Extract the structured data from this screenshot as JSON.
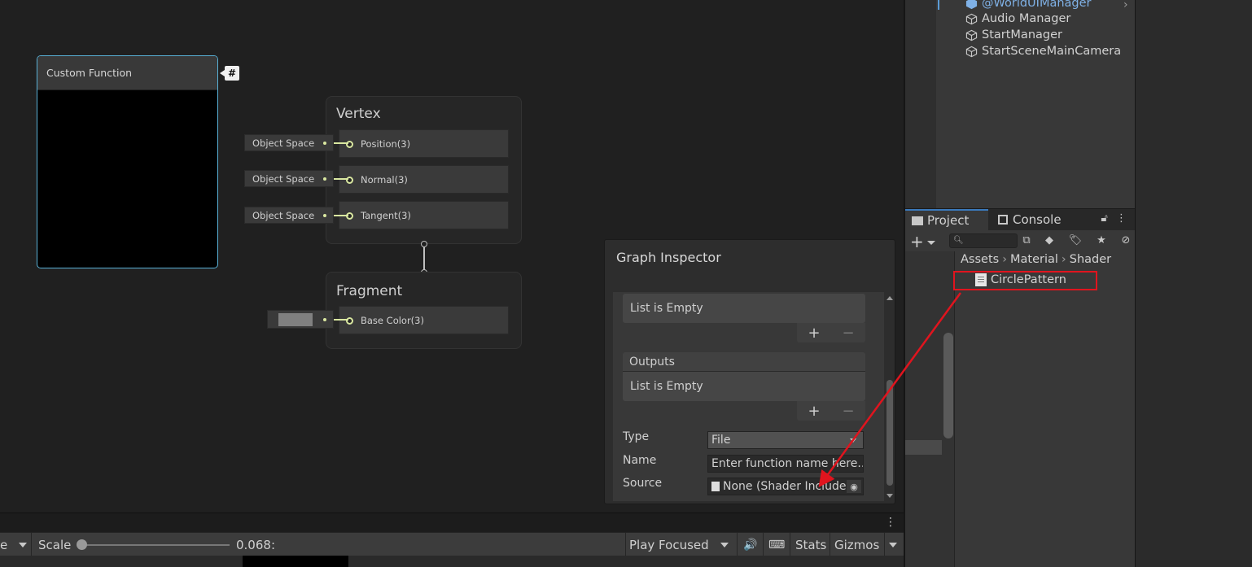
{
  "graph": {
    "custom_function_title": "Custom Function",
    "hash_badge": "#",
    "vertex": {
      "title": "Vertex",
      "slots": [
        {
          "label": "Position(3)",
          "input": "Object Space"
        },
        {
          "label": "Normal(3)",
          "input": "Object Space"
        },
        {
          "label": "Tangent(3)",
          "input": "Object Space"
        }
      ]
    },
    "fragment": {
      "title": "Fragment",
      "slots": [
        {
          "label": "Base Color(3)",
          "input_color": "#808080"
        }
      ]
    }
  },
  "inspector": {
    "title": "Graph Inspector",
    "inputs_empty": "List is Empty",
    "outputs_header": "Outputs",
    "outputs_empty": "List is Empty",
    "plus": "+",
    "minus": "−",
    "type_label": "Type",
    "type_value": "File",
    "name_label": "Name",
    "name_placeholder": "Enter function name here...",
    "source_label": "Source",
    "source_value": "None (Shader Include)"
  },
  "toolbar": {
    "left_fragment": "e",
    "scale_label": "Scale",
    "scale_value": "0.068:",
    "play_mode": "Play Focused",
    "stats": "Stats",
    "gizmos": "Gizmos"
  },
  "hierarchy": {
    "items": [
      "@WorldUIManager",
      "Audio Manager",
      "StartManager",
      "StartSceneMainCamera"
    ]
  },
  "project": {
    "tabs": [
      "Project",
      "Console"
    ],
    "breadcrumb": [
      "Assets",
      "Material",
      "Shader"
    ],
    "files": [
      "CirclePattern"
    ]
  },
  "colors": {
    "accent": "#3a79bb",
    "selection_outline": "#58b0d6",
    "annotation_red": "#e0141e",
    "port": "#d9e7a0"
  }
}
